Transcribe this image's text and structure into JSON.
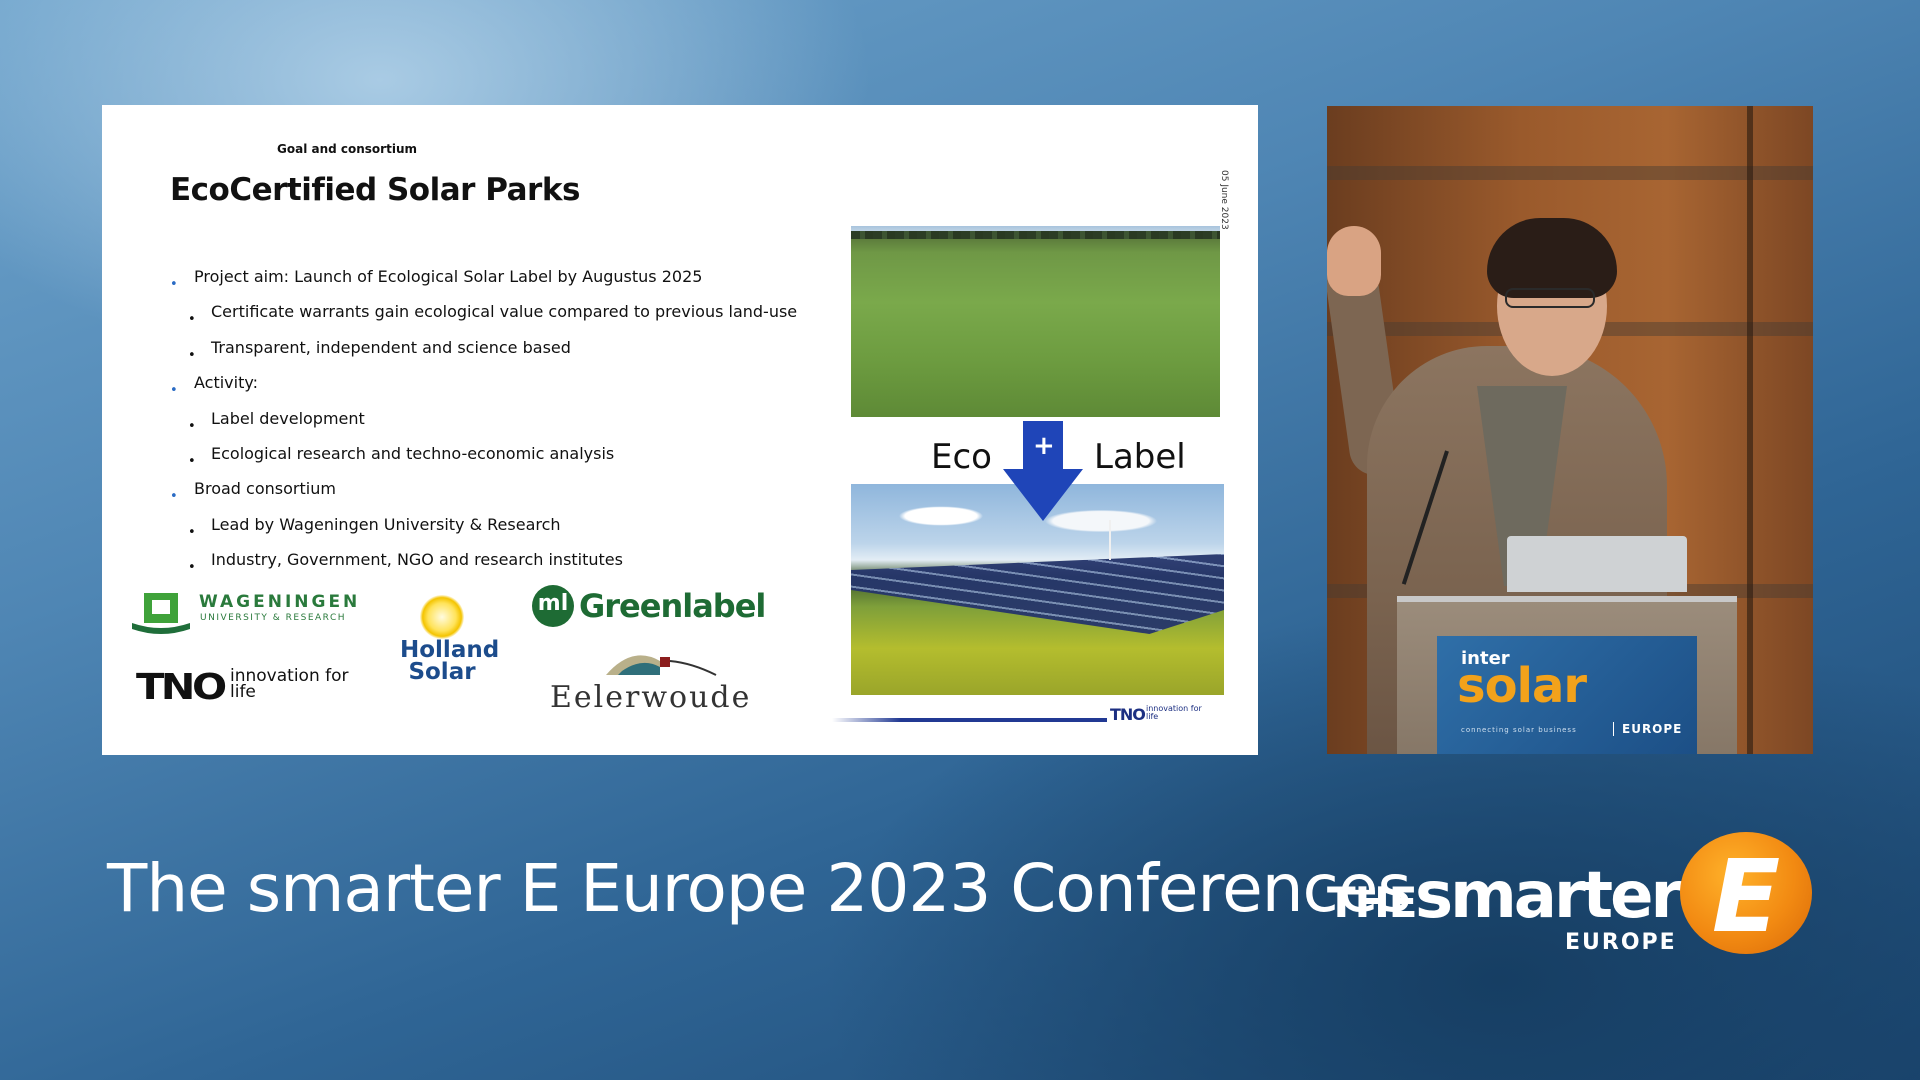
{
  "slide": {
    "kicker": "Goal and consortium",
    "title": "EcoCertified Solar Parks",
    "date": "05 June 2023",
    "bullets": [
      {
        "level": 1,
        "text": "Project aim: Launch of Ecological Solar Label by Augustus 2025"
      },
      {
        "level": 2,
        "text": "Certificate warrants gain ecological value compared to previous land-use"
      },
      {
        "level": 2,
        "text": "Transparent, independent and science based"
      },
      {
        "level": 1,
        "text": "Activity:"
      },
      {
        "level": 2,
        "text": "Label development"
      },
      {
        "level": 2,
        "text": "Ecological research and techno-economic analysis"
      },
      {
        "level": 1,
        "text": "Broad consortium"
      },
      {
        "level": 2,
        "text": "Lead by Wageningen University & Research"
      },
      {
        "level": 2,
        "text": "Industry, Government, NGO and research institutes"
      }
    ],
    "graphic": {
      "eco": "Eco",
      "plus": "+",
      "label": "Label",
      "arrow_color": "#1f45b8",
      "top_image": "grass-field-photo",
      "bottom_image": "solar-park-photo"
    },
    "logos": {
      "wageningen_name": "WAGENINGEN",
      "wageningen_sub": "UNIVERSITY & RESEARCH",
      "tno": "TNO",
      "tno_tagline": "innovation for life",
      "holland_solar": "Holland Solar",
      "greenlabel_mark": "ml",
      "greenlabel": "Greenlabel",
      "eelerwoude": "Eelerwoude"
    },
    "footer": {
      "tno": "TNO",
      "tagline": "innovation for life"
    }
  },
  "video": {
    "podium_brand_small": "inter",
    "podium_brand_big": "solar",
    "podium_tagline": "connecting solar business",
    "podium_region": "EUROPE"
  },
  "banner": {
    "title": "The smarter E Europe 2023 Conferences",
    "brand_the": "THE",
    "brand_smarter": "smarter",
    "brand_letter": "E",
    "brand_region": "EUROPE",
    "brand_color": "#f28a12"
  }
}
